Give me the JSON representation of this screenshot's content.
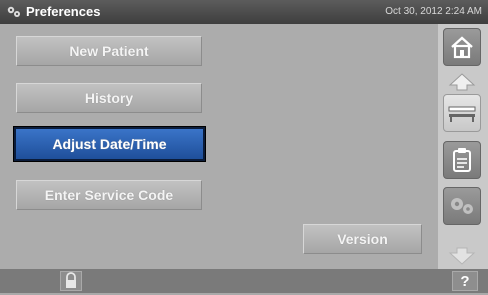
{
  "header": {
    "title": "Preferences",
    "datetime": "Oct 30, 2012 2:24 AM",
    "icon": "gears-icon"
  },
  "menu": {
    "new_patient": "New Patient",
    "history": "History",
    "adjust_datetime": "Adjust Date/Time",
    "enter_service_code": "Enter Service Code",
    "version": "Version",
    "selected": "Adjust Date/Time"
  },
  "sidebar": {
    "icons": [
      "home-icon",
      "scroll-up-icon",
      "patient-bed-icon",
      "clipboard-icon",
      "gears-icon",
      "scroll-down-icon"
    ]
  },
  "footer": {
    "lock_icon": "lock-icon",
    "help_label": "?"
  },
  "colors": {
    "selected_button": "#2a5fb0",
    "header_bg": "#4a4a4a",
    "body_bg": "#acacac"
  }
}
